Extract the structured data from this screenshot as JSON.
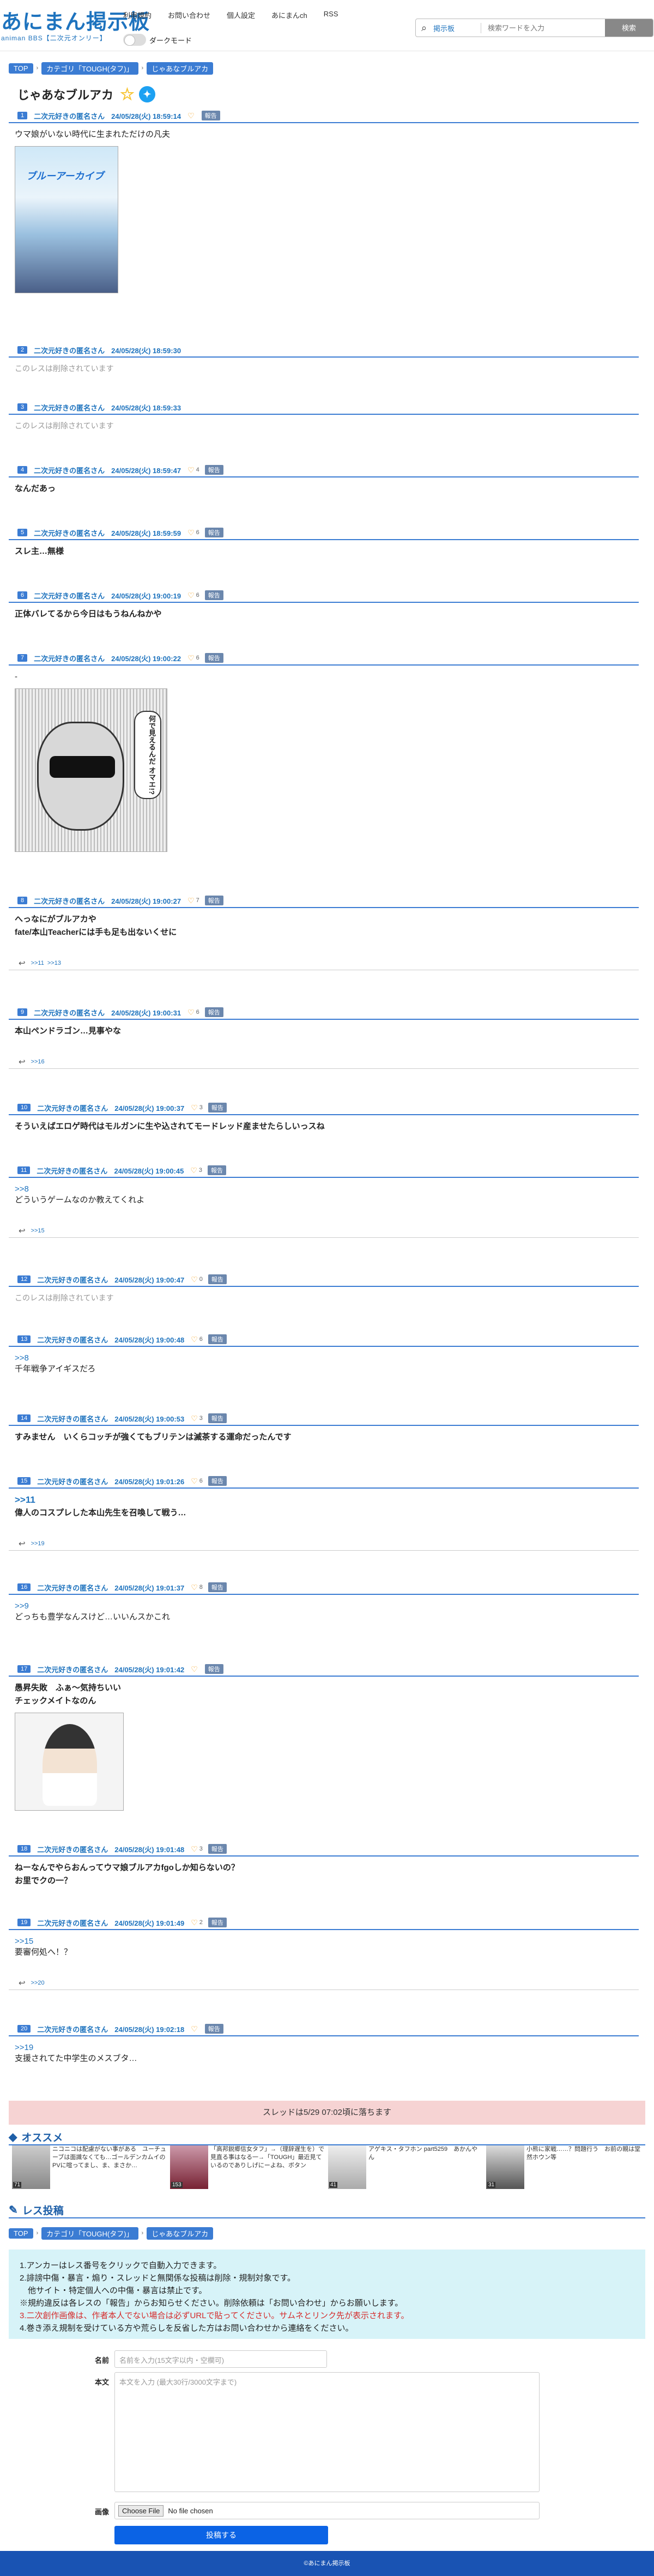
{
  "site": {
    "logo": "あにまん掲示板",
    "tagline": "animan BBS【二次元オンリー】",
    "dark_label": "ダークモード"
  },
  "nav": [
    "利用規約",
    "お問い合わせ",
    "個人設定",
    "あにまんch",
    "RSS"
  ],
  "search": {
    "scope": "掲示板",
    "placeholder": "検索ワードを入力",
    "button": "検索"
  },
  "breadcrumb": [
    "TOP",
    "カテゴリ「TOUGH(タフ)」",
    "じゃあなブルアカ"
  ],
  "thread": {
    "title": "じゃあなブルアカ"
  },
  "report_label": "報告",
  "deleted_text": "このレスは削除されています",
  "posts": [
    {
      "no": "1",
      "name": "二次元好きの匿名さん",
      "date": "24/05/28(火) 18:59:14",
      "likes": "",
      "lines": [
        "ウマ娘がいない時代に生まれただけの凡夫"
      ],
      "img_caption": "ブルーアーカイブ"
    },
    {
      "no": "2",
      "name": "二次元好きの匿名さん",
      "date": "24/05/28(火) 18:59:30"
    },
    {
      "no": "3",
      "name": "二次元好きの匿名さん",
      "date": "24/05/28(火) 18:59:33"
    },
    {
      "no": "4",
      "name": "二次元好きの匿名さん",
      "date": "24/05/28(火) 18:59:47",
      "likes": "4",
      "lines": [
        "なんだあっ"
      ]
    },
    {
      "no": "5",
      "name": "二次元好きの匿名さん",
      "date": "24/05/28(火) 18:59:59",
      "likes": "6",
      "lines": [
        "スレ主…無様"
      ]
    },
    {
      "no": "6",
      "name": "二次元好きの匿名さん",
      "date": "24/05/28(火) 19:00:19",
      "likes": "6",
      "lines": [
        "正体バレてるから今日はもうねんねかや"
      ]
    },
    {
      "no": "7",
      "name": "二次元好きの匿名さん",
      "date": "24/05/28(火) 19:00:22",
      "likes": "6",
      "lines": [
        "-"
      ],
      "img_caption": "何で見えるんだ オマエ!?"
    },
    {
      "no": "8",
      "name": "二次元好きの匿名さん",
      "date": "24/05/28(火) 19:00:27",
      "likes": "7",
      "lines": [
        "へっなにがブルアカや",
        "fate/本山Teacherには手も足も出ないくせに"
      ],
      "replies": [
        ">>11",
        ">>13"
      ]
    },
    {
      "no": "9",
      "name": "二次元好きの匿名さん",
      "date": "24/05/28(火) 19:00:31",
      "likes": "6",
      "lines": [
        "本山ペンドラゴン…見事やな"
      ],
      "replies": [
        ">>16"
      ]
    },
    {
      "no": "10",
      "name": "二次元好きの匿名さん",
      "date": "24/05/28(火) 19:00:37",
      "likes": "3",
      "lines": [
        "そういえばエロゲ時代はモルガンに生や込されてモードレッド産ませたらしいっスね"
      ]
    },
    {
      "no": "11",
      "name": "二次元好きの匿名さん",
      "date": "24/05/28(火) 19:00:45",
      "likes": "3",
      "anchor": ">>8",
      "lines": [
        "どういうゲームなのか教えてくれよ"
      ],
      "replies": [
        ">>15"
      ]
    },
    {
      "no": "12",
      "name": "二次元好きの匿名さん",
      "date": "24/05/28(火) 19:00:47",
      "likes": "0"
    },
    {
      "no": "13",
      "name": "二次元好きの匿名さん",
      "date": "24/05/28(火) 19:00:48",
      "likes": "6",
      "anchor": ">>8",
      "lines": [
        "千年戦争アイギスだろ"
      ]
    },
    {
      "no": "14",
      "name": "二次元好きの匿名さん",
      "date": "24/05/28(火) 19:00:53",
      "likes": "3",
      "lines": [
        "すみません　いくらコッチが強くてもブリテンは滅茶する運命だったんです"
      ]
    },
    {
      "no": "15",
      "name": "二次元好きの匿名さん",
      "date": "24/05/28(火) 19:01:26",
      "likes": "6",
      "anchor": ">>11",
      "lines": [
        "偉人のコスプレした本山先生を召喚して戦う…"
      ],
      "replies": [
        ">>19"
      ]
    },
    {
      "no": "16",
      "name": "二次元好きの匿名さん",
      "date": "24/05/28(火) 19:01:37",
      "likes": "8",
      "anchor": ">>9",
      "lines": [
        "どっちも豊学なんスけど…いいんスかこれ"
      ]
    },
    {
      "no": "17",
      "name": "二次元好きの匿名さん",
      "date": "24/05/28(火) 19:01:42",
      "likes": "",
      "lines": [
        "愚昇失敗　ふぁ〜気持ちいい",
        "チェックメイトなのん"
      ],
      "img_caption": ""
    },
    {
      "no": "18",
      "name": "二次元好きの匿名さん",
      "date": "24/05/28(火) 19:01:48",
      "likes": "3",
      "lines": [
        "ねーなんでやらおんってウマ娘ブルアカfgoしか知らないの？",
        "お里でクの一？"
      ]
    },
    {
      "no": "19",
      "name": "二次元好きの匿名さん",
      "date": "24/05/28(火) 19:01:49",
      "likes": "2",
      "anchor": ">>15",
      "lines": [
        "要審何処へ！？"
      ],
      "replies": [
        ">>20"
      ]
    },
    {
      "no": "20",
      "name": "二次元好きの匿名さん",
      "date": "24/05/28(火) 19:02:18",
      "likes": "",
      "anchor": ">>19",
      "lines": [
        "支援されてた中学生のメスブタ…"
      ]
    }
  ],
  "drop_notice": "スレッドは5/29 07:02頃に落ちます",
  "recommend": {
    "heading": "オススメ",
    "items": [
      {
        "title": "ニコニコは配慮がない事がある　ユーチューブは面識なくても…ゴールデンカムイのPVに喧ってまし、ま、まさか…",
        "count": "71"
      },
      {
        "title": "「高邦鋭郷信女タフ」→（理辞遅生を）で見直る事はなる一→「TOUGH」最近見ているのでありしげにーよね、ボタン",
        "count": "153"
      },
      {
        "title": "アゲキス・タフホン part5259　あかんやん",
        "count": "41"
      },
      {
        "title": "小熊に家戦……？問題行う　お前の親は堂然ホウン等",
        "count": "31"
      }
    ]
  },
  "post_form": {
    "heading": "レス投稿",
    "rules": [
      "1.アンカーはレス番号をクリックで自動入力できます。",
      "2.誹謗中傷・暴言・煽り・スレッドと無関係な投稿は削除・規制対象です。",
      "　他サイト・特定個人への中傷・暴言は禁止です。",
      "※規約違反は各レスの「報告」からお知らせください。削除依頼は「お問い合わせ」からお願いします。",
      "3.二次創作画像は、作者本人でない場合は必ずURLで貼ってください。サムネとリンク先が表示されます。",
      "4.巻き添え規制を受けている方や荒らしを反省した方はお問い合わせから連絡をください。"
    ],
    "name_label": "名前",
    "name_placeholder": "名前を入力(15文字以内・空欄可)",
    "body_label": "本文",
    "body_placeholder": "本文を入力 (最大30行/3000文字まで)",
    "image_label": "画像",
    "file_button": "Choose File",
    "file_status": "No file chosen",
    "submit": "投稿する"
  },
  "footer": "©あにまん掲示板",
  "colors": {
    "primary": "#3b7cd3",
    "link": "#1e73be",
    "drop_notice_bg": "#f6d3d3",
    "rules_bg": "#d7f3f8",
    "submit": "#0b63e5",
    "footer": "#1953b3"
  }
}
